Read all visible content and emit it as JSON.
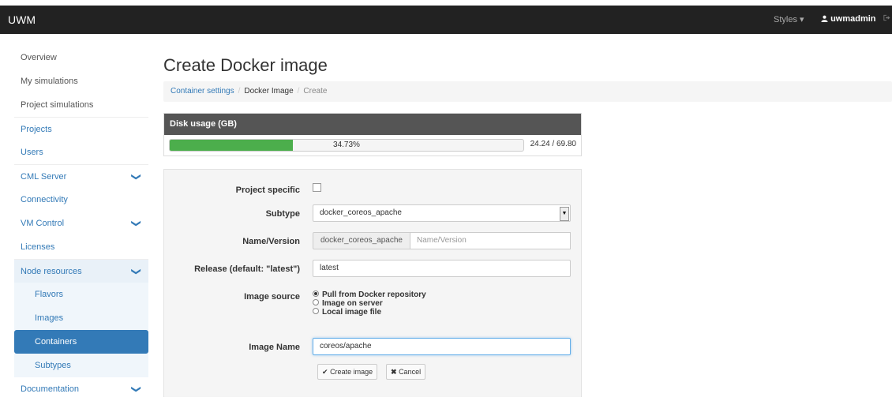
{
  "navbar": {
    "brand": "UWM",
    "styles_label": "Styles",
    "styles_caret": "▾",
    "user_icon": "user-icon",
    "user_name": "uwmadmin",
    "logout_icon": "logout-icon"
  },
  "sidebar": {
    "items": [
      {
        "label": "Overview"
      },
      {
        "label": "My simulations"
      },
      {
        "label": "Project simulations"
      },
      {
        "label": "Projects"
      },
      {
        "label": "Users"
      },
      {
        "label": "CML Server"
      },
      {
        "label": "Connectivity"
      },
      {
        "label": "VM Control"
      },
      {
        "label": "Licenses"
      },
      {
        "label": "Node resources"
      },
      {
        "label": "Flavors"
      },
      {
        "label": "Images"
      },
      {
        "label": "Containers"
      },
      {
        "label": "Subtypes"
      },
      {
        "label": "Documentation"
      }
    ],
    "chevron": "❯"
  },
  "page": {
    "title": "Create Docker image"
  },
  "breadcrumb": {
    "items": [
      "Container settings",
      "Docker Image",
      "Create"
    ],
    "separator": "/"
  },
  "disk": {
    "header": "Disk usage (GB)",
    "percent_label": "34.73%",
    "percent": 34.73,
    "usage": "24.24 / 69.80"
  },
  "form": {
    "project_specific_label": "Project specific",
    "project_specific_checked": false,
    "subtype_label": "Subtype",
    "subtype_value": "docker_coreos_apache",
    "name_label": "Name/Version",
    "name_prefix": "docker_coreos_apache",
    "name_placeholder": "Name/Version",
    "release_label": "Release (default: \"latest\")",
    "release_value": "latest",
    "source_label": "Image source",
    "source_options": [
      "Pull from Docker repository",
      "Image on server",
      "Local image file"
    ],
    "source_selected": "Pull from Docker repository",
    "image_name_label": "Image Name",
    "image_name_value": "coreos/apache",
    "create_button": "Create image",
    "cancel_button": "Cancel"
  },
  "colors": {
    "navbar": "#222222",
    "link": "#337ab7",
    "progress": "#4cae4c",
    "active": "#337ab7"
  }
}
